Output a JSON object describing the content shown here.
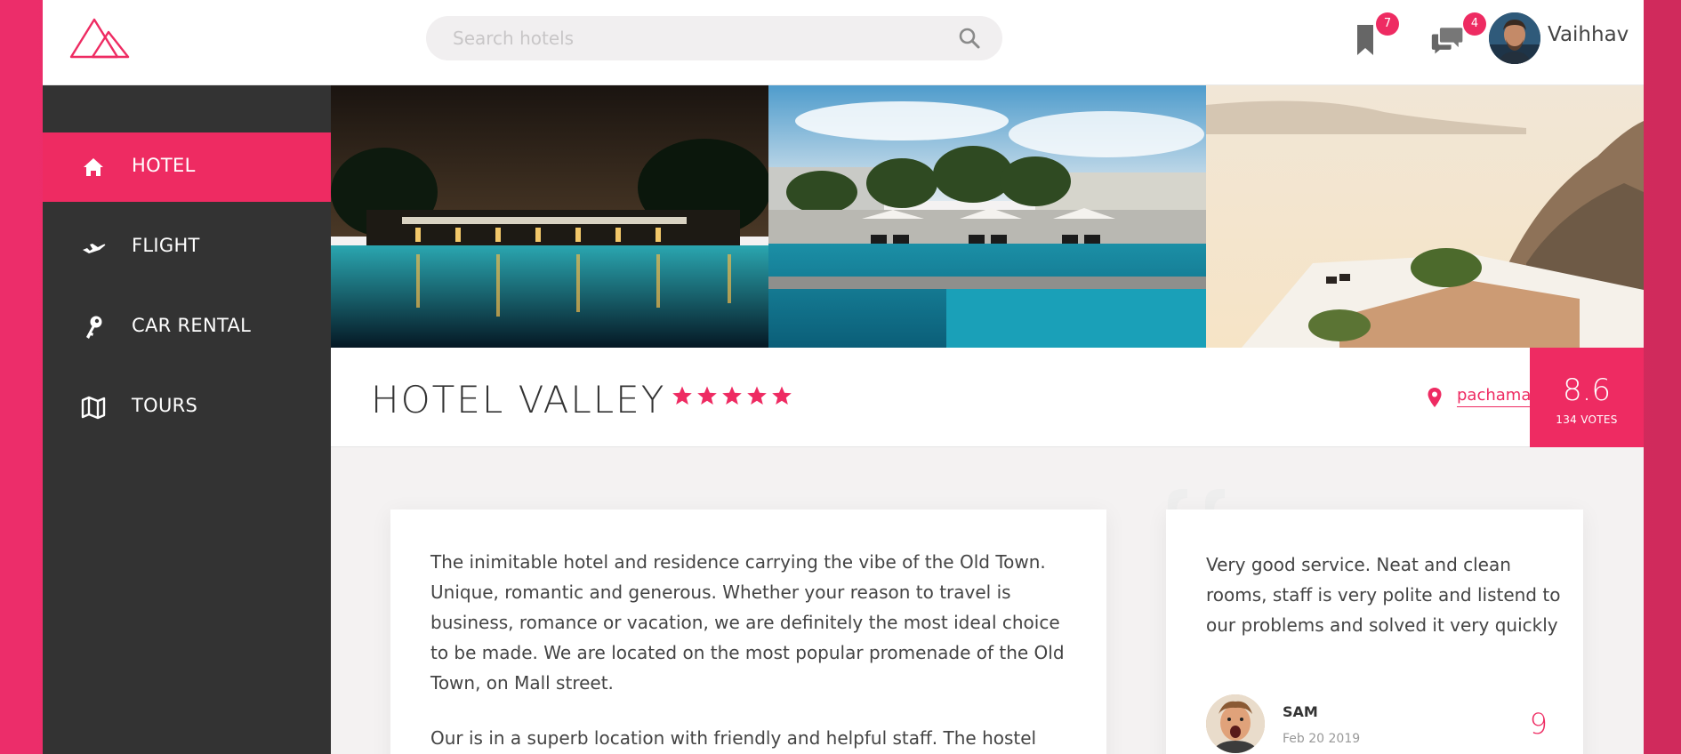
{
  "app": {
    "logo": "mountain-logo"
  },
  "header": {
    "search_placeholder": "Search hotels",
    "bookmarks_count": "7",
    "messages_count": "4",
    "user_name": "Vaihhav"
  },
  "sidebar": {
    "items": [
      {
        "label": "HOTEL",
        "icon": "home-icon",
        "active": true
      },
      {
        "label": "FLIGHT",
        "icon": "plane-icon",
        "active": false
      },
      {
        "label": "CAR RENTAL",
        "icon": "key-icon",
        "active": false
      },
      {
        "label": "TOURS",
        "icon": "map-icon",
        "active": false
      }
    ]
  },
  "gallery": [
    "night-pool-photo",
    "day-pool-photo",
    "cliff-terrace-photo"
  ],
  "hotel": {
    "name": "HOTEL VALLEY",
    "stars": 5,
    "location": "pachamari",
    "score": "8.6",
    "votes": "134 VOTES"
  },
  "description": {
    "paragraphs": [
      "The inimitable hotel and residence carrying the vibe of the Old Town. Unique, romantic and generous. Whether your reason to travel is business, romance or vacation, we are definitely the most ideal choice to be made. We are located on the most popular promenade of the Old Town, on Mall street.",
      "Our is in a superb location with friendly and helpful staff. The hostel"
    ]
  },
  "review": {
    "text": "Very good service. Neat and clean rooms, staff is very polite and listend to our problems and solved it very quickly",
    "author": "SAM",
    "date": "Feb 20 2019",
    "score": "9"
  },
  "colors": {
    "accent": "#ee2b62",
    "sidebar_bg": "#333333",
    "page_bg": "#f4f2f2"
  }
}
